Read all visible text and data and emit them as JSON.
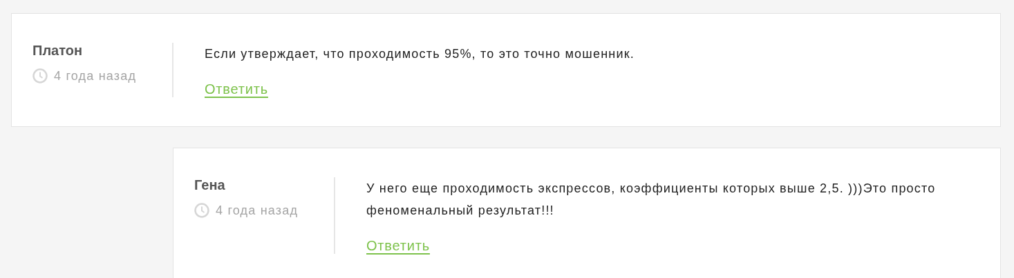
{
  "comments": [
    {
      "author": "Платон",
      "time": "4 года назад",
      "text": "Если утверждает, что проходимость 95%, то это точно мошенник.",
      "reply_link": "Ответить",
      "children": [
        {
          "author": "Гена",
          "time": "4 года назад",
          "text": "У него еще проходимость экспрессов, коэффициенты которых выше 2,5. )))Это просто феноменальный результат!!!",
          "reply_link": "Ответить"
        }
      ]
    }
  ]
}
